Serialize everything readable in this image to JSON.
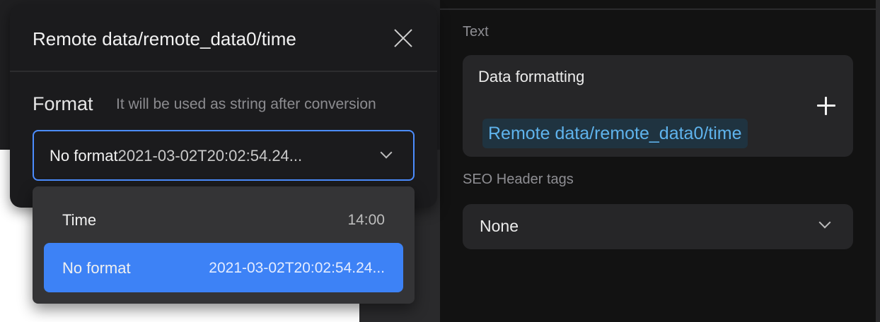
{
  "dialog": {
    "title": "Remote data/remote_data0/time",
    "format_label": "Format",
    "format_hint": "It will be used as string after conversion",
    "select": {
      "selected_name": "No format",
      "selected_sample": "2021-03-02T20:02:54.24..."
    },
    "options": [
      {
        "name": "Time",
        "sample": "14:00",
        "selected": false
      },
      {
        "name": "No format",
        "sample": "2021-03-02T20:02:54.24...",
        "selected": true
      }
    ]
  },
  "right_panel": {
    "text_section_label": "Text",
    "data_formatting_title": "Data formatting",
    "data_token": "Remote data/remote_data0/time",
    "seo_label": "SEO Header tags",
    "seo_value": "None"
  },
  "icons": [
    "close-icon",
    "chevron-down-icon",
    "plus-icon"
  ],
  "colors": {
    "accent": "#3d82f6",
    "focus_border": "#4c8dff",
    "token_text": "#5fb3ec"
  }
}
